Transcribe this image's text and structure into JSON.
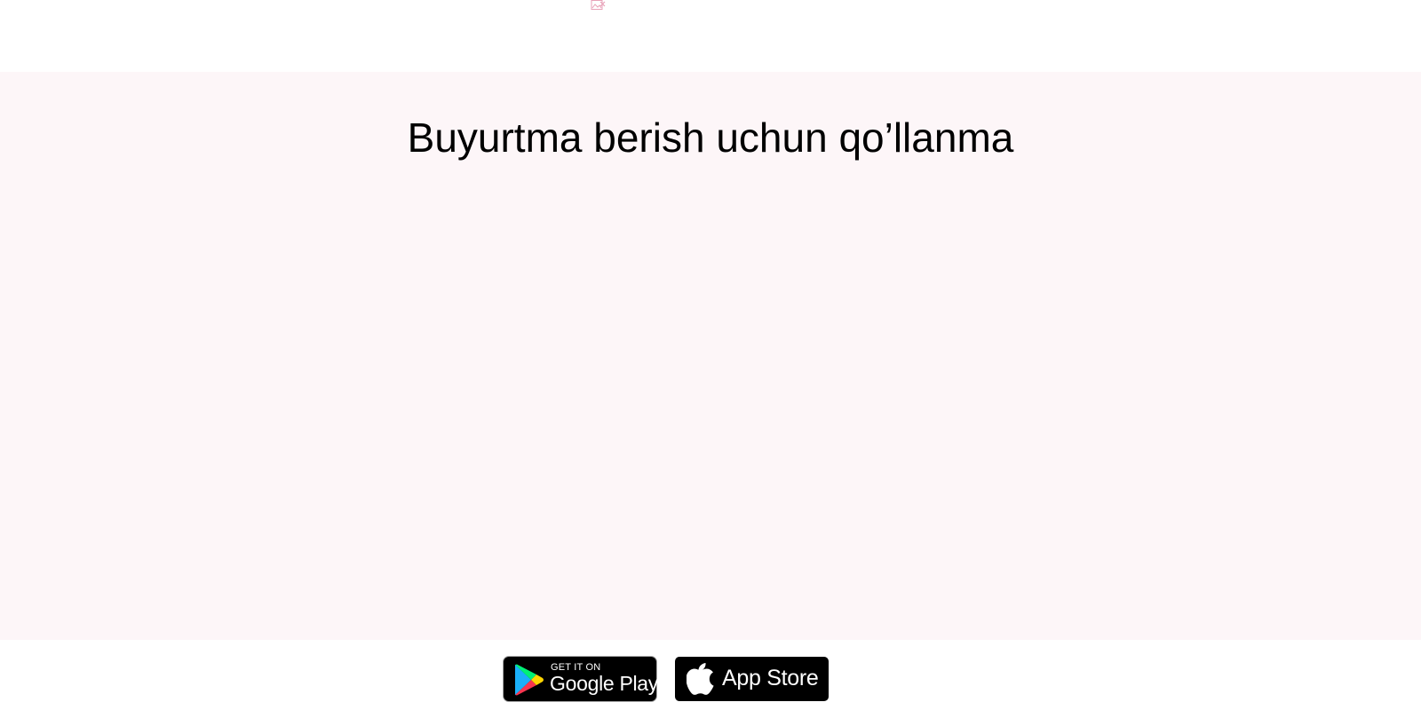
{
  "header": {
    "logo_icon": "broken-image-icon"
  },
  "guide": {
    "title": "Buyurtma berish uchun qo’llanma",
    "background_color": "#fdf6f8"
  },
  "footer": {
    "google_play": {
      "small_text": "GET IT ON",
      "big_text": "Google Play",
      "icon": "google-play-icon"
    },
    "app_store": {
      "text": "App Store",
      "icon": "apple-icon"
    }
  }
}
